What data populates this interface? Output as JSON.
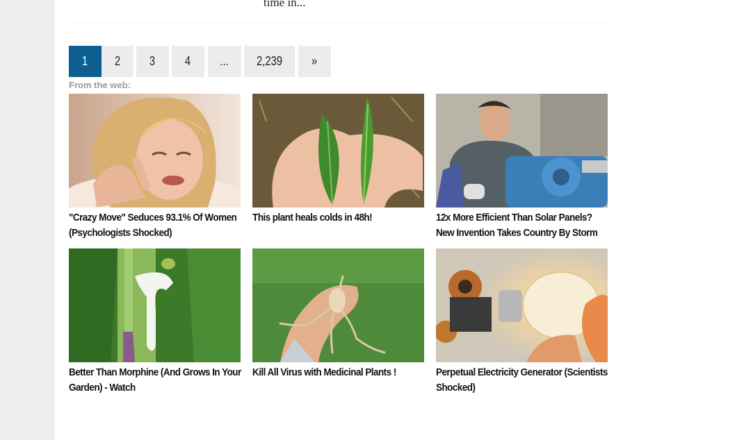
{
  "article": {
    "snippet": "time in..."
  },
  "pagination": {
    "pages": [
      "1",
      "2",
      "3",
      "4",
      "...",
      "2,239",
      "»"
    ],
    "active_index": 0
  },
  "recommendations": {
    "header": "From the web:",
    "items": [
      {
        "title": "\"Crazy Move\" Seduces 93.1% Of Women (Psychologists Shocked)",
        "image": "woman-laughing-photo"
      },
      {
        "title": "This plant heals colds in 48h!",
        "image": "plant-leaves-in-hand-photo"
      },
      {
        "title": "12x More Efficient Than Solar Panels? New Invention Takes Country By Storm",
        "image": "man-with-machine-photo"
      },
      {
        "title": "Better Than Morphine (And Grows In Your Garden) - Watch",
        "image": "plant-stem-sap-photo"
      },
      {
        "title": "Kill All Virus with Medicinal Plants !",
        "image": "root-in-hand-photo"
      },
      {
        "title": "Perpetual Electricity Generator (Scientists Shocked)",
        "image": "lightbulb-coil-photo"
      }
    ]
  },
  "colors": {
    "active_page": "#0d5f92",
    "page_bg": "#ececec",
    "rail": "#ededed"
  }
}
